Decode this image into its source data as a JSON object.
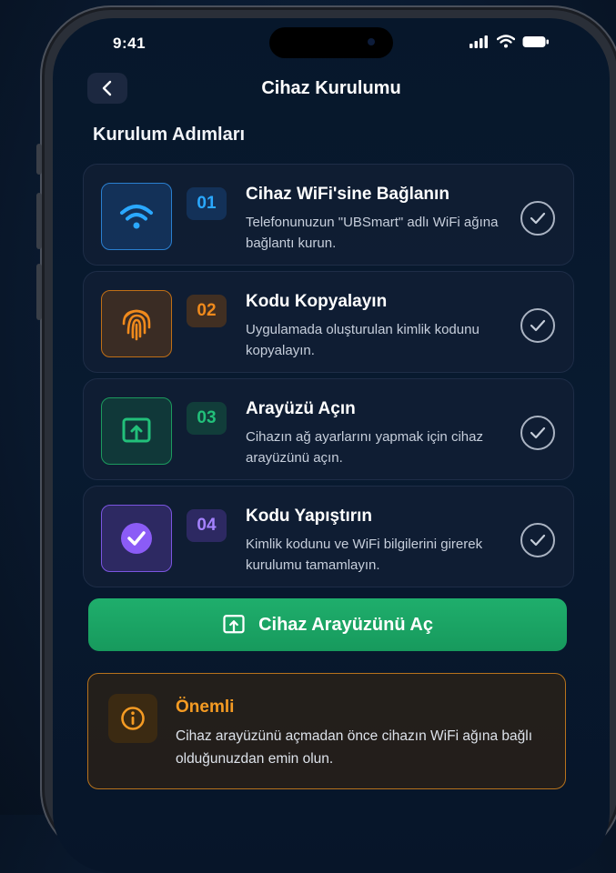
{
  "status_bar": {
    "time": "9:41"
  },
  "header": {
    "title": "Cihaz Kurulumu"
  },
  "section": {
    "title": "Kurulum Adımları"
  },
  "steps": [
    {
      "number": "01",
      "title": "Cihaz WiFi'sine Bağlanın",
      "description": "Telefonunuzun \"UBSmart\" adlı WiFi ağına bağlantı kurun.",
      "icon": "wifi-icon",
      "color": "#2aa8ff"
    },
    {
      "number": "02",
      "title": "Kodu Kopyalayın",
      "description": "Uygulamada oluşturulan kimlik kodunu kopyalayın.",
      "icon": "fingerprint-icon",
      "color": "#f08a1c"
    },
    {
      "number": "03",
      "title": "Arayüzü Açın",
      "description": "Cihazın ağ ayarlarını yapmak için cihaz arayüzünü açın.",
      "icon": "open-interface-icon",
      "color": "#22c07a"
    },
    {
      "number": "04",
      "title": "Kodu Yapıştırın",
      "description": "Kimlik kodunu ve WiFi bilgilerini girerek kurulumu tamamlayın.",
      "icon": "check-circle-icon",
      "color": "#8b5cf6"
    }
  ],
  "cta": {
    "label": "Cihaz Arayüzünü Aç",
    "icon": "open-interface-icon",
    "color": "#1fae6c"
  },
  "notice": {
    "title": "Önemli",
    "text": "Cihaz arayüzünü açmadan önce cihazın WiFi ağına bağlı olduğunuzdan emin olun.",
    "icon": "info-icon",
    "color": "#f59b23"
  }
}
